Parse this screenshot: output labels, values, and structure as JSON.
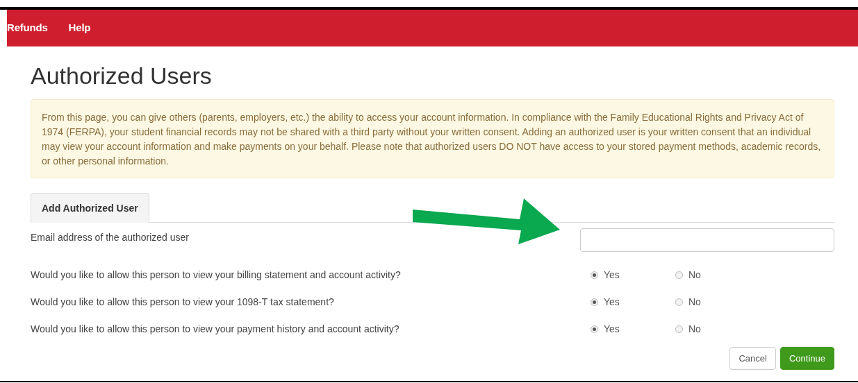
{
  "nav": {
    "items": [
      "Refunds",
      "Help"
    ]
  },
  "page_title": "Authorized Users",
  "notice": "From this page, you can give others (parents, employers, etc.) the ability to access your account information. In compliance with the Family Educational Rights and Privacy Act of 1974 (FERPA), your student financial records may not be shared with a third party without your written consent. Adding an authorized user is your written consent that an individual may view your account information and make payments on your behalf. Please note that authorized users DO NOT have access to your stored payment methods, academic records, or other personal information.",
  "tabs": [
    {
      "label": "Add Authorized User",
      "selected": true
    }
  ],
  "email_field": {
    "label": "Email address of the authorized user"
  },
  "questions": [
    {
      "text": "Would you like to allow this person to view your billing statement and account activity?",
      "options": [
        {
          "label": "Yes",
          "selected": true
        },
        {
          "label": "No",
          "selected": false
        }
      ]
    },
    {
      "text": "Would you like to allow this person to view your 1098-T tax statement?",
      "options": [
        {
          "label": "Yes",
          "selected": true
        },
        {
          "label": "No",
          "selected": false
        }
      ]
    },
    {
      "text": "Would you like to allow this person to view your payment history and account activity?",
      "options": [
        {
          "label": "Yes",
          "selected": true
        },
        {
          "label": "No",
          "selected": false
        }
      ]
    }
  ],
  "buttons": [
    {
      "label": "Cancel",
      "kind": "secondary"
    },
    {
      "label": "Continue",
      "kind": "primary"
    }
  ]
}
